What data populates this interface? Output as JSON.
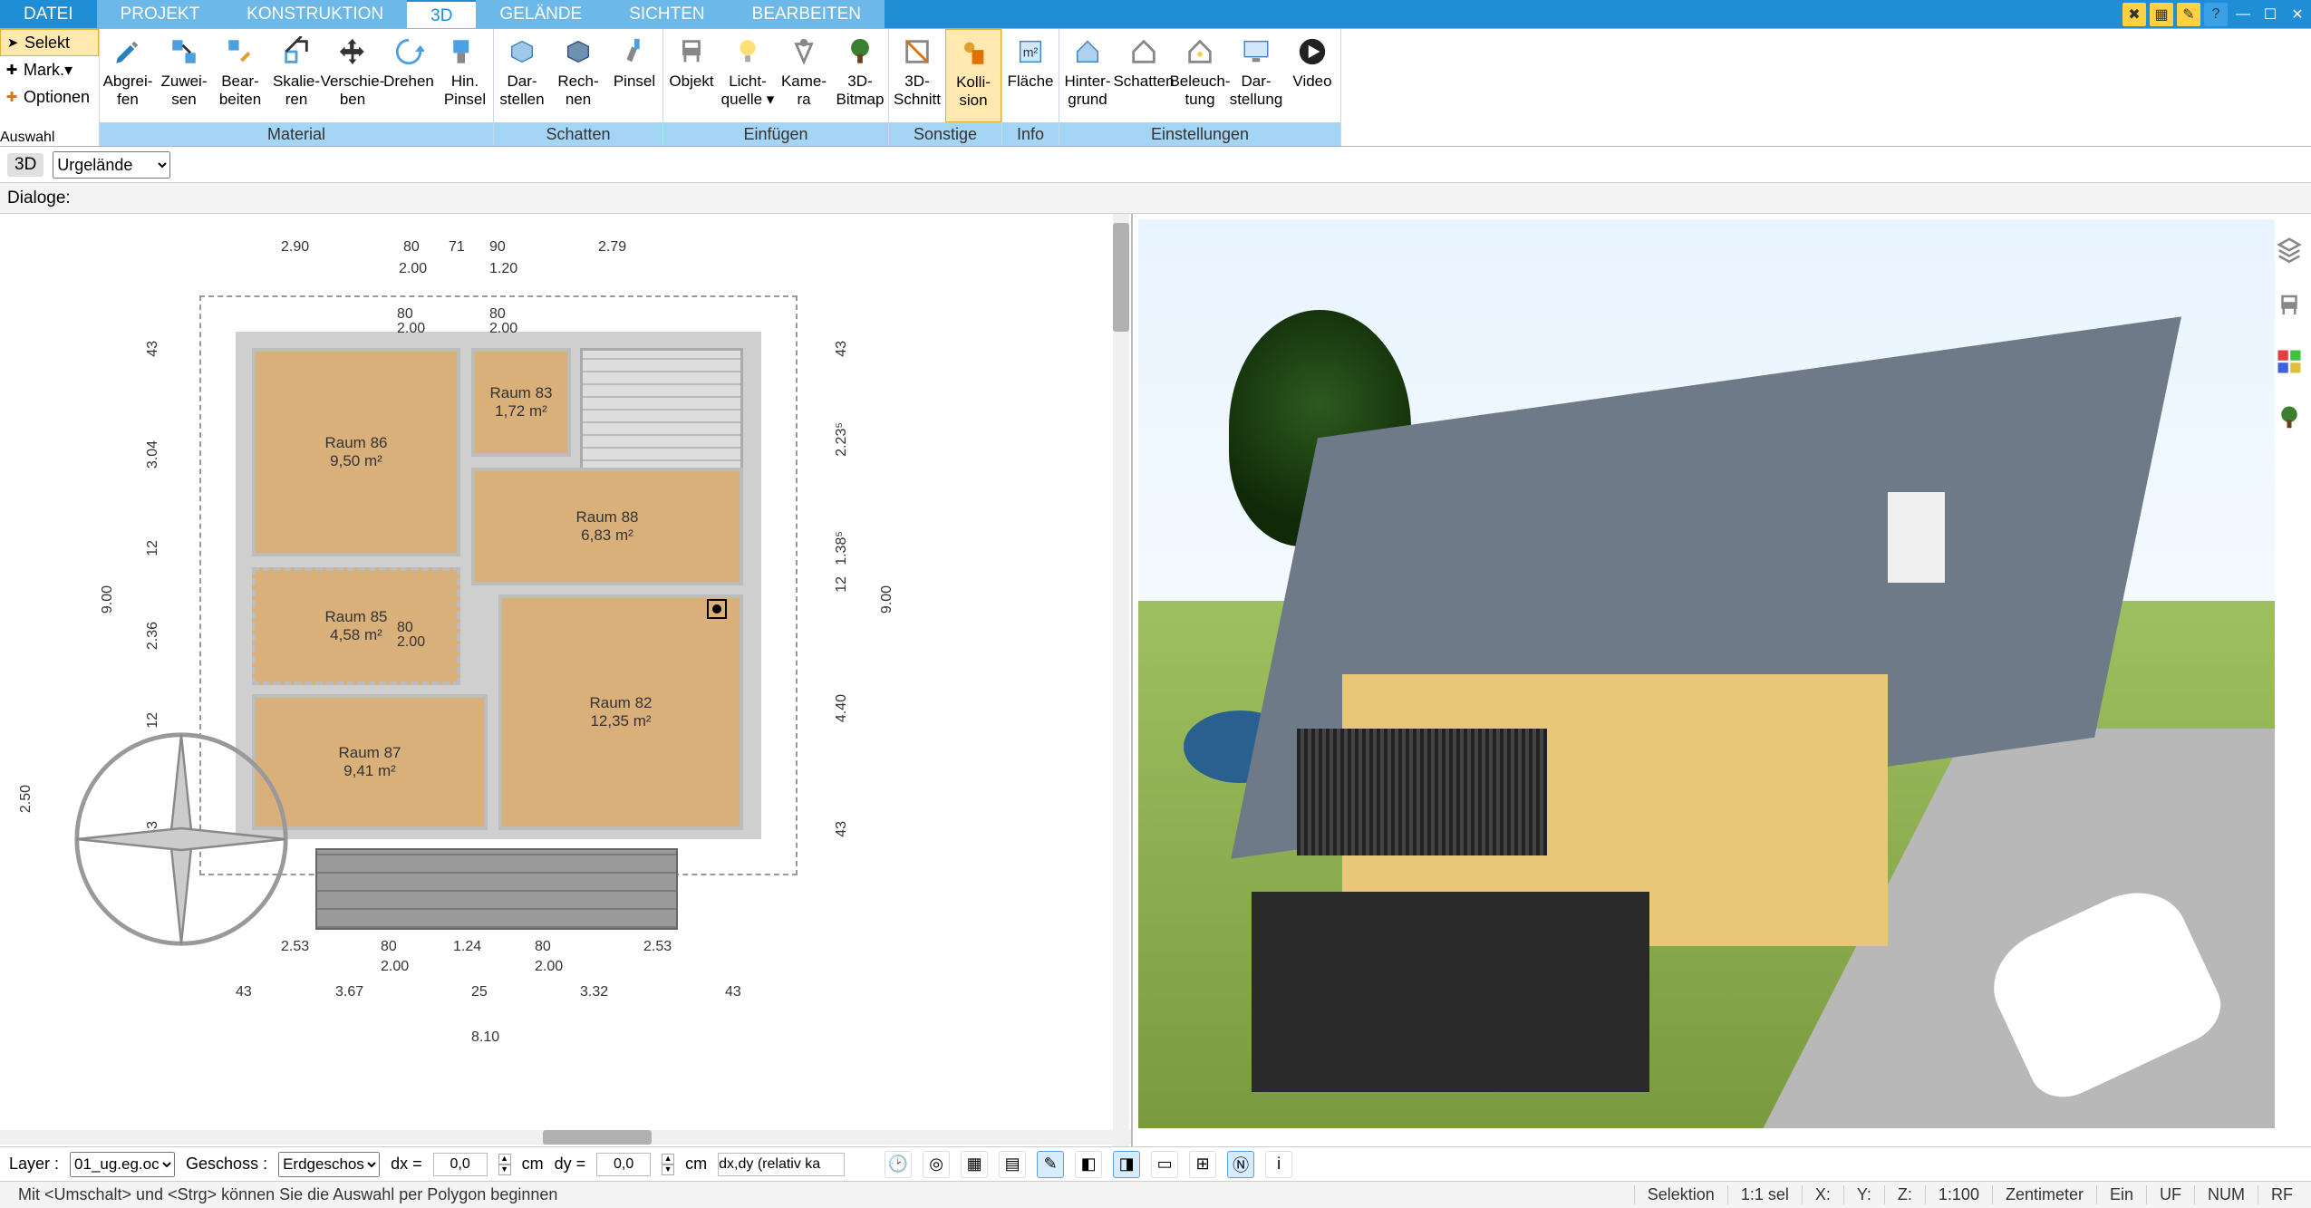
{
  "menu": {
    "tabs": [
      "DATEI",
      "PROJEKT",
      "KONSTRUKTION",
      "3D",
      "GELÄNDE",
      "SICHTEN",
      "BEARBEITEN"
    ],
    "active_index": 3
  },
  "ribbon": {
    "left": {
      "selekt": "Selekt",
      "mark": "Mark.",
      "optionen": "Optionen"
    },
    "groups": [
      {
        "label": "Auswahl",
        "buttons": []
      },
      {
        "label": "Material",
        "buttons": [
          {
            "id": "abgreifen",
            "line1": "Abgrei-",
            "line2": "fen"
          },
          {
            "id": "zuweisen",
            "line1": "Zuwei-",
            "line2": "sen"
          },
          {
            "id": "bearbeiten",
            "line1": "Bear-",
            "line2": "beiten"
          },
          {
            "id": "skalieren",
            "line1": "Skalie-",
            "line2": "ren"
          },
          {
            "id": "verschieben",
            "line1": "Verschie-",
            "line2": "ben"
          },
          {
            "id": "drehen",
            "line1": "Drehen",
            "line2": ""
          },
          {
            "id": "hinpinsel",
            "line1": "Hin.",
            "line2": "Pinsel"
          }
        ]
      },
      {
        "label": "Schatten",
        "buttons": [
          {
            "id": "darstellen",
            "line1": "Dar-",
            "line2": "stellen"
          },
          {
            "id": "rechnen",
            "line1": "Rech-",
            "line2": "nen"
          },
          {
            "id": "pinsel",
            "line1": "Pinsel",
            "line2": ""
          }
        ]
      },
      {
        "label": "Einfügen",
        "buttons": [
          {
            "id": "objekt",
            "line1": "Objekt",
            "line2": ""
          },
          {
            "id": "lichtquelle",
            "line1": "Licht-",
            "line2": "quelle ▾"
          },
          {
            "id": "kamera",
            "line1": "Kame-",
            "line2": "ra"
          },
          {
            "id": "3dbitmap",
            "line1": "3D-",
            "line2": "Bitmap"
          }
        ]
      },
      {
        "label": "Sonstige",
        "buttons": [
          {
            "id": "3dschnitt",
            "line1": "3D-",
            "line2": "Schnitt"
          },
          {
            "id": "kollision",
            "line1": "Kolli-",
            "line2": "sion",
            "active": true
          }
        ]
      },
      {
        "label": "Info",
        "buttons": [
          {
            "id": "flaeche",
            "line1": "Fläche",
            "line2": ""
          }
        ]
      },
      {
        "label": "Einstellungen",
        "buttons": [
          {
            "id": "hintergrund",
            "line1": "Hinter-",
            "line2": "grund"
          },
          {
            "id": "schatten",
            "line1": "Schatten",
            "line2": ""
          },
          {
            "id": "beleuchtung",
            "line1": "Beleuch-",
            "line2": "tung"
          },
          {
            "id": "darstellung",
            "line1": "Dar-",
            "line2": "stellung"
          },
          {
            "id": "video",
            "line1": "Video",
            "line2": ""
          }
        ]
      }
    ]
  },
  "secbar": {
    "mode": "3D",
    "terrain": "Urgelände"
  },
  "dlgbar": {
    "label": "Dialoge:"
  },
  "plan": {
    "rooms": [
      {
        "id": "r86",
        "name": "Raum 86",
        "area": "9,50 m²"
      },
      {
        "id": "r83",
        "name": "Raum 83",
        "area": "1,72 m²"
      },
      {
        "id": "r88",
        "name": "Raum 88",
        "area": "6,83 m²"
      },
      {
        "id": "r85",
        "name": "Raum 85",
        "area": "4,58 m²"
      },
      {
        "id": "r87",
        "name": "Raum 87",
        "area": "9,41 m²"
      },
      {
        "id": "r82",
        "name": "Raum 82",
        "area": "12,35 m²"
      }
    ],
    "dims_top": [
      "2.90",
      "80",
      "71",
      "90",
      "2.79"
    ],
    "dims_top2": [
      "2.00",
      "1.20"
    ],
    "dims_left": [
      "43",
      "3.04",
      "12",
      "2.36",
      "12",
      "43"
    ],
    "dims_left_outer": "9.00",
    "dims_right_outer": "9.00",
    "dims_right": [
      "43",
      "2.23⁵",
      "1.38⁵",
      "12",
      "4.40",
      "43"
    ],
    "dims_bottom": [
      "2.53",
      "80",
      "1.24",
      "80",
      "2.53"
    ],
    "dims_bottom2": [
      "2.00",
      "2.00"
    ],
    "dims_bottom3": [
      "43",
      "3.67",
      "25",
      "3.32",
      "43"
    ],
    "dims_total": "8.10",
    "door_dims": [
      "80",
      "2.00",
      "80",
      "2.00",
      "80",
      "2.00",
      "80",
      "2.00",
      "80",
      "2.00",
      "80",
      "2.00"
    ],
    "compass_dim": "2.50"
  },
  "bottom": {
    "layer_label": "Layer :",
    "layer_value": "01_ug.eg.oc",
    "geschoss_label": "Geschoss :",
    "geschoss_value": "Erdgeschos",
    "dx_label": "dx =",
    "dx_value": "0,0",
    "dy_label": "dy =",
    "dy_value": "0,0",
    "unit": "cm",
    "hint": "dx,dy (relativ ka"
  },
  "status": {
    "help": "Mit <Umschalt> und <Strg> können Sie die Auswahl per Polygon beginnen",
    "selektion": "Selektion",
    "sel_count": "1:1 sel",
    "x": "X:",
    "y": "Y:",
    "z": "Z:",
    "scale": "1:100",
    "unit": "Zentimeter",
    "ein": "Ein",
    "uf": "UF",
    "num": "NUM",
    "rf": "RF"
  }
}
